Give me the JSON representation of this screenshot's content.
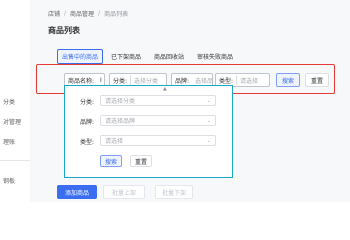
{
  "sidebar": {
    "items": [
      {
        "label": "分类"
      },
      {
        "label": "对管理"
      },
      {
        "label": "理账"
      },
      {
        "label": "钢板"
      }
    ]
  },
  "breadcrumb": {
    "items": [
      "店铺",
      "商品管理",
      "商品列表"
    ],
    "separator": "/"
  },
  "page": {
    "title": "商品列表"
  },
  "tabs": [
    {
      "label": "出售中的商品",
      "active": true
    },
    {
      "label": "已下架商品",
      "active": false
    },
    {
      "label": "商品回收站",
      "active": false
    },
    {
      "label": "审核失败商品",
      "active": false
    }
  ],
  "filter": {
    "name_label": "商品名称:",
    "name_value": "I",
    "category_label": "分类:",
    "category_placeholder": "选择分类",
    "brand_label": "品牌:",
    "brand_placeholder": "选择品",
    "type_label": "类型:",
    "type_placeholder": "请选择",
    "search_label": "搜索",
    "reset_label": "重置"
  },
  "dropdown_panel": {
    "category_label": "分类:",
    "category_placeholder": "请选择分类",
    "brand_label": "品牌:",
    "brand_placeholder": "请选择品牌",
    "type_label": "类型:",
    "type_placeholder": "请选择",
    "search_label": "搜索",
    "reset_label": "重置"
  },
  "footer": {
    "primary_label": "添加商品",
    "ghost_label": "批量上架",
    "ghost2_label": "批量下架"
  },
  "colors": {
    "accent": "#3a6df0",
    "highlight_red": "#e53935",
    "highlight_teal": "#1aa8c4"
  }
}
